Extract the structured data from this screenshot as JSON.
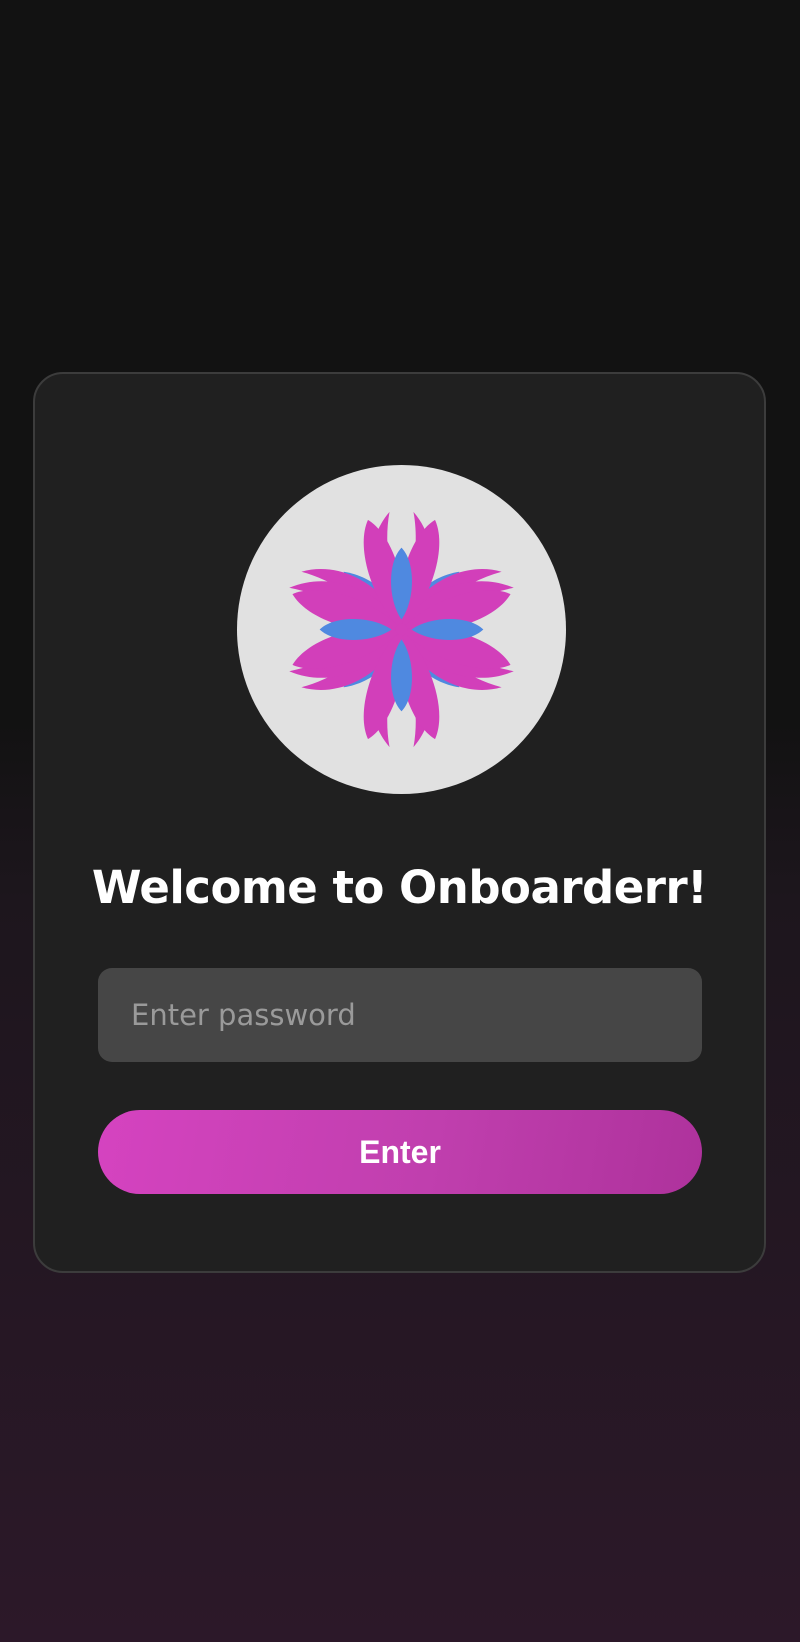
{
  "logo": {
    "icon": "flower-icon",
    "background_color": "#e1e1e1",
    "petal_colors": [
      "#d23fba",
      "#4f89e0"
    ]
  },
  "login": {
    "title": "Welcome to Onboarderr!",
    "password_placeholder": "Enter password",
    "password_value": "",
    "submit_label": "Enter"
  },
  "colors": {
    "accent": "#d543c0",
    "card_background": "#202020",
    "input_background": "#464646",
    "page_background_top": "#121212",
    "page_background_bottom": "#2c1829"
  }
}
